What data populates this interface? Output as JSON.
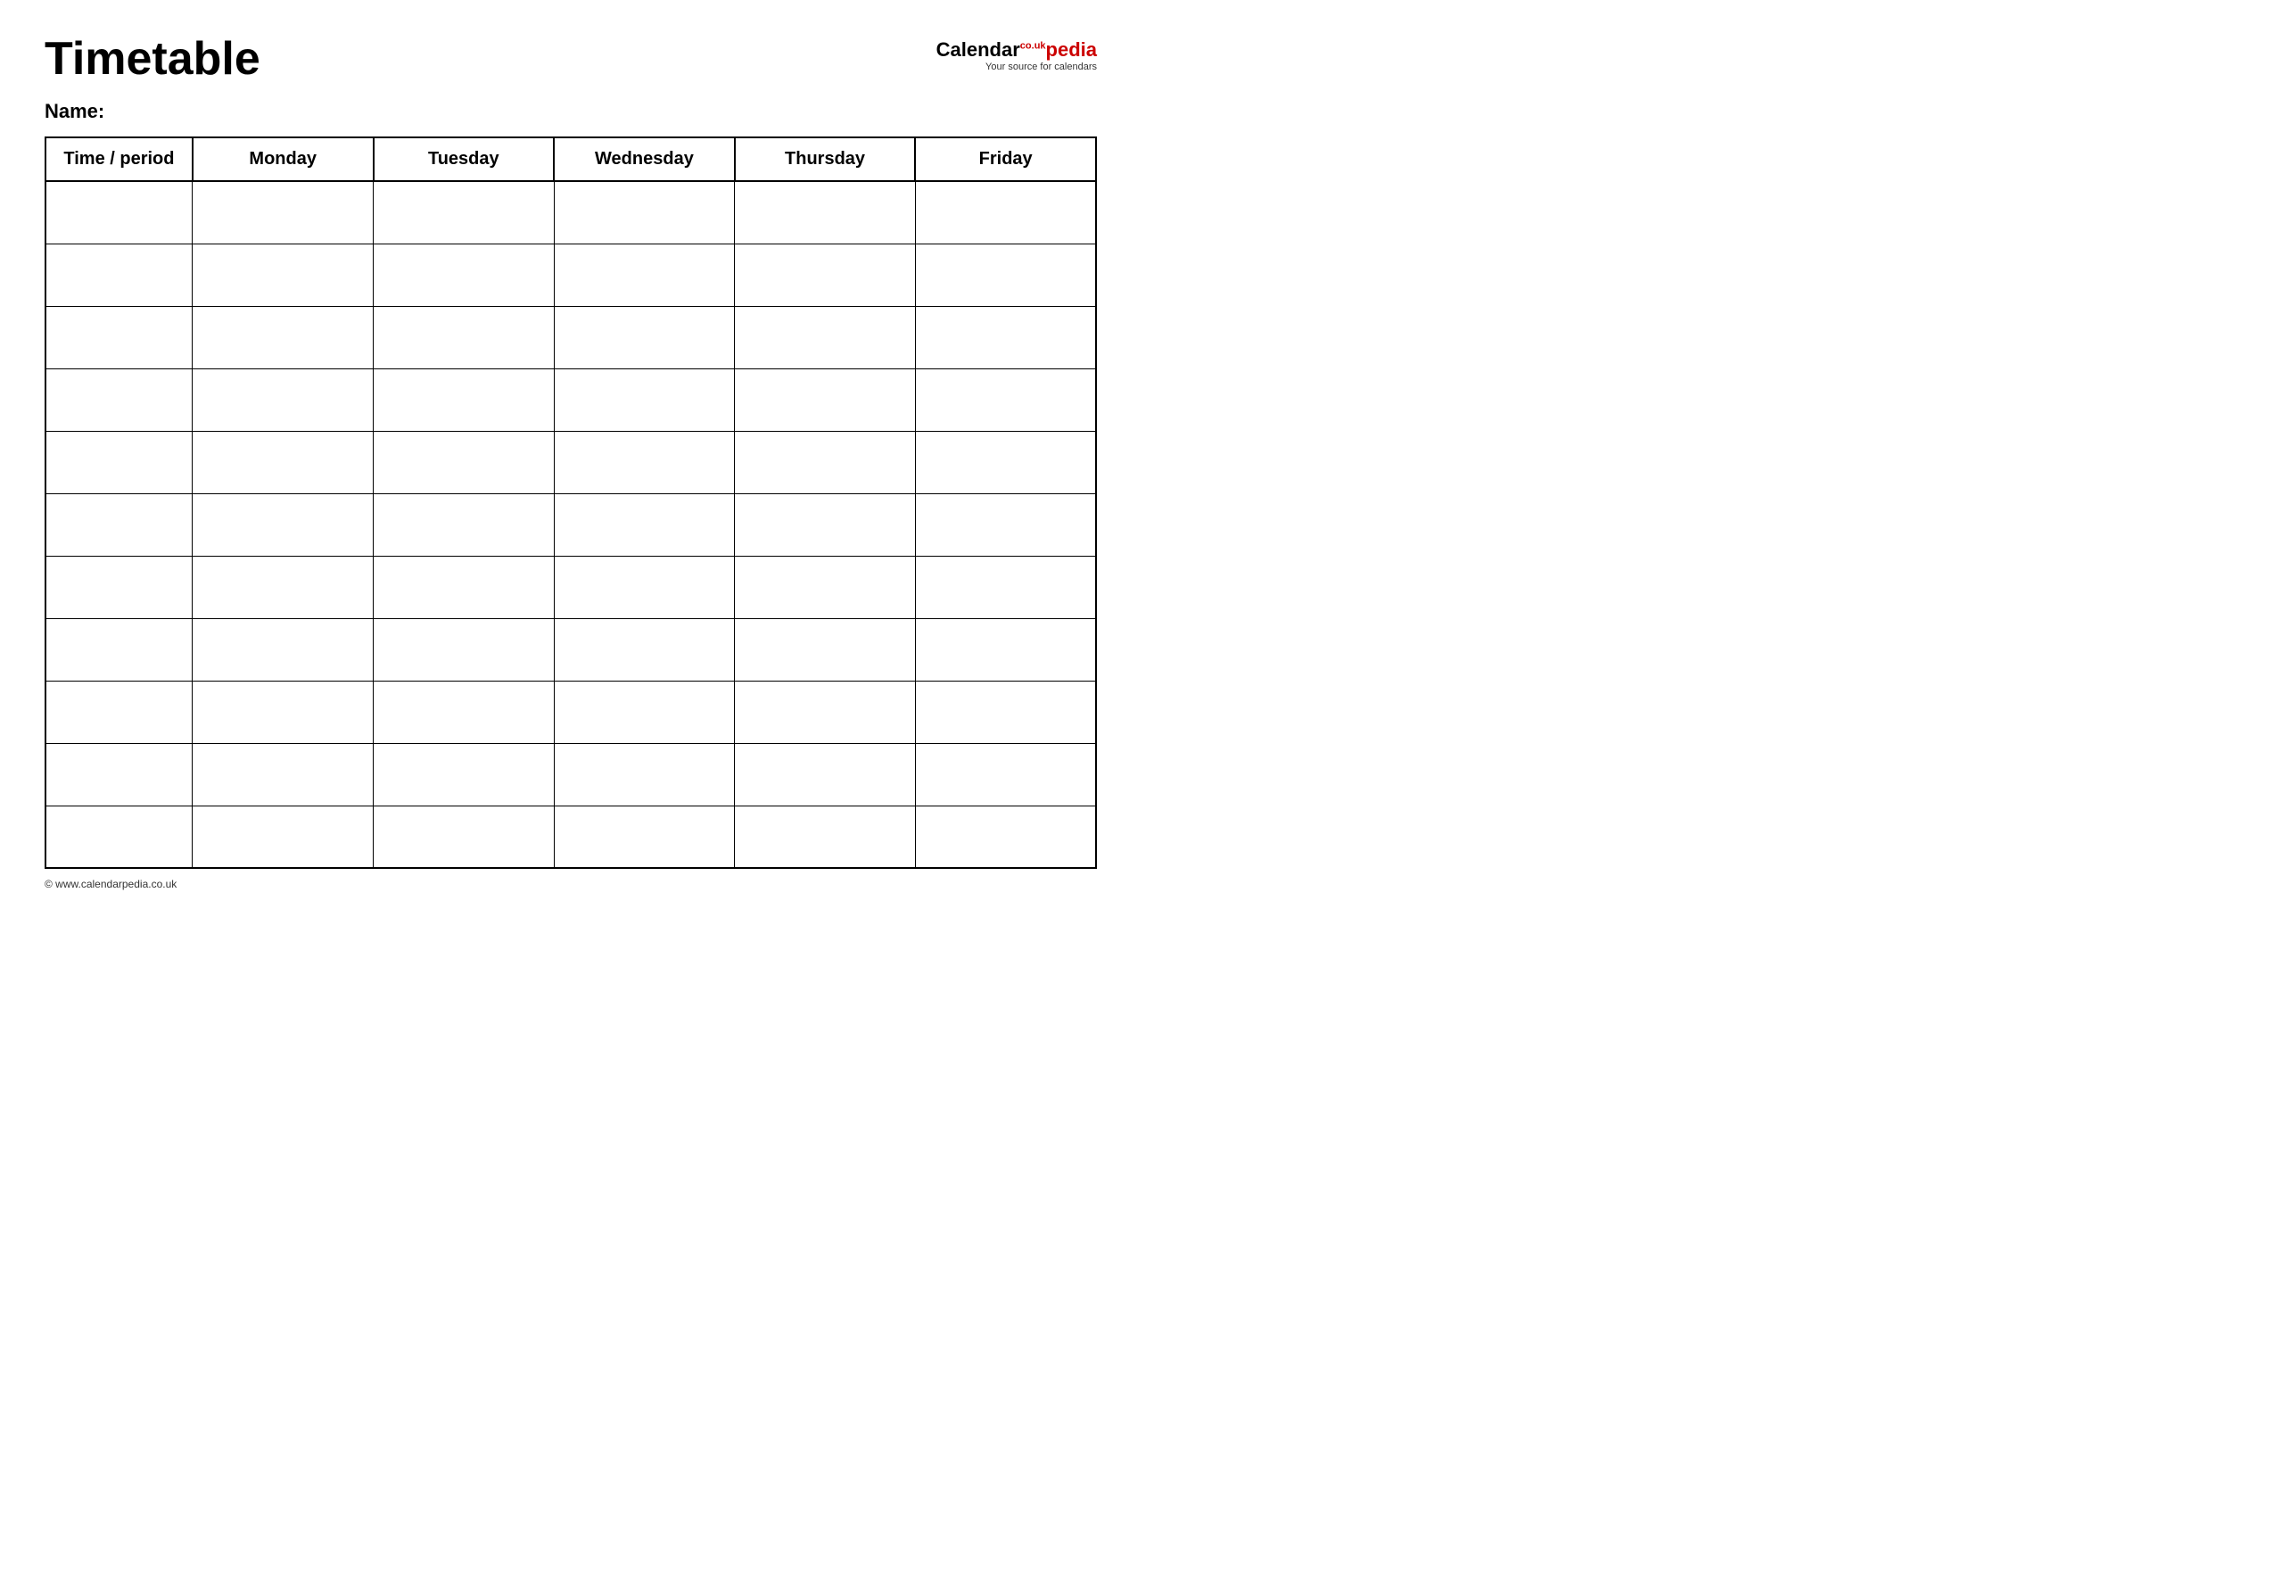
{
  "header": {
    "title": "Timetable",
    "logo": {
      "calendar_text": "Calendar",
      "pedia_text": "pedia",
      "co_uk": "co.uk",
      "subtitle": "Your source for calendars"
    }
  },
  "name_label": "Name:",
  "table": {
    "columns": [
      "Time / period",
      "Monday",
      "Tuesday",
      "Wednesday",
      "Thursday",
      "Friday"
    ],
    "row_count": 11
  },
  "footer": {
    "url": "www.calendarpedia.co.uk"
  }
}
